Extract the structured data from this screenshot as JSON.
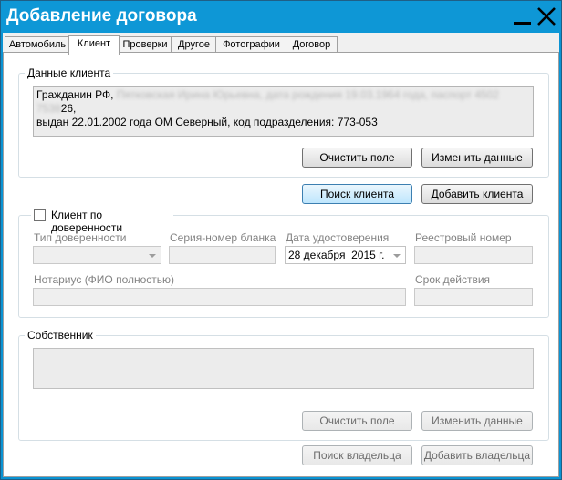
{
  "window": {
    "title": "Добавление договора"
  },
  "tabs": [
    {
      "label": "Автомобиль"
    },
    {
      "label": "Клиент"
    },
    {
      "label": "Проверки"
    },
    {
      "label": "Другое"
    },
    {
      "label": "Фотографии"
    },
    {
      "label": "Договор"
    }
  ],
  "client_data": {
    "legend": "Данные клиента",
    "text_prefix": "Гражданин РФ,",
    "text_redacted": "Пятковская Ирина Юрьевна, дата рождения 19.03.1964 года, паспорт 4502 7538",
    "text_line1_end": "26,",
    "text_line2": "выдан 22.01.2002 года ОМ Северный, код подразделения: 773-053",
    "clear_button": "Очистить поле",
    "edit_button": "Изменить данные"
  },
  "actions": {
    "search_client": "Поиск клиента",
    "add_client": "Добавить клиента"
  },
  "proxy": {
    "checkbox_label": "Клиент по доверенности",
    "checked": false,
    "type_label": "Тип доверенности",
    "serial_label": "Серия-номер бланка",
    "date_label": "Дата удостоверения",
    "date_value": "28 декабря  2015 г.",
    "registry_label": "Реестровый номер",
    "notary_label": "Нотариус (ФИО полностью)",
    "validity_label": "Срок действия"
  },
  "owner": {
    "legend": "Собственник",
    "clear_button": "Очистить поле",
    "edit_button": "Изменить данные",
    "search_button": "Поиск владельца",
    "add_button": "Добавить владельца"
  }
}
